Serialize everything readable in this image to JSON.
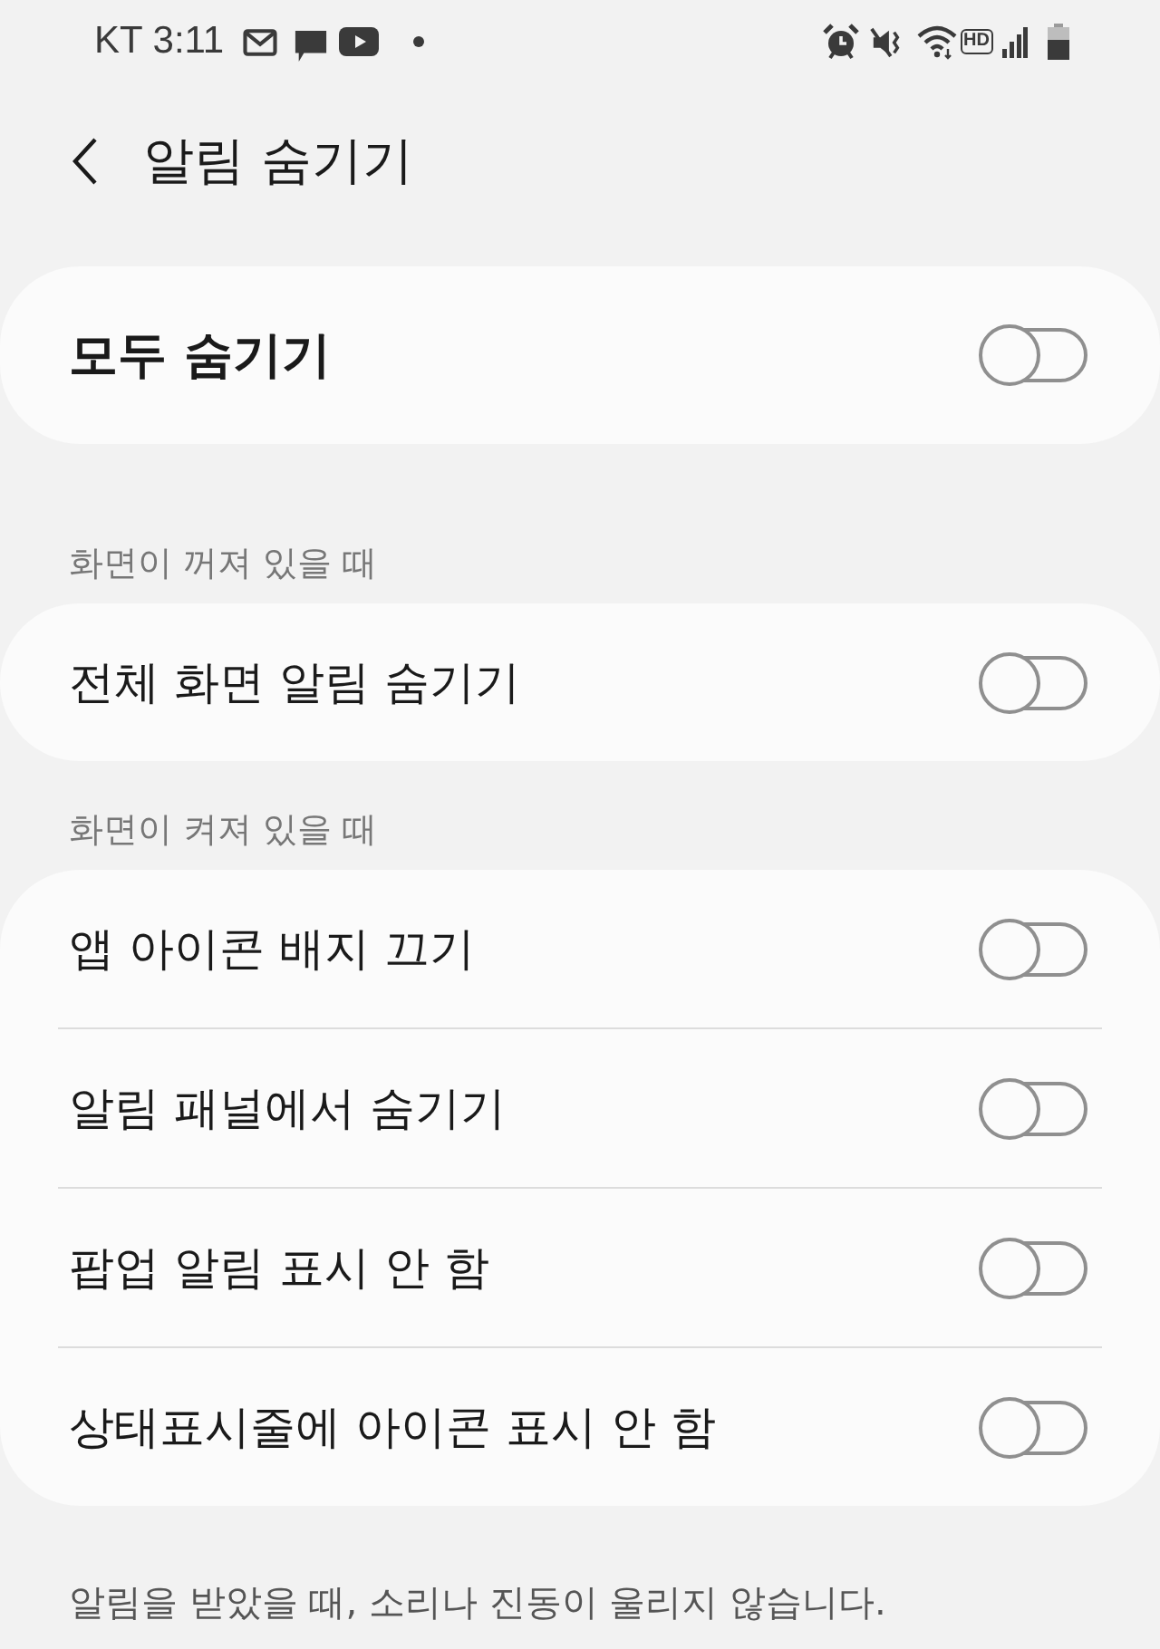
{
  "status_bar": {
    "carrier_time": "KT 3:11",
    "hd_badge": "HD"
  },
  "header": {
    "title": "알림 숨기기"
  },
  "master": {
    "label": "모두 숨기기",
    "on": false
  },
  "sections": [
    {
      "header": "화면이 꺼져 있을 때",
      "items": [
        {
          "label": "전체 화면 알림 숨기기",
          "on": false
        }
      ]
    },
    {
      "header": "화면이 켜져 있을 때",
      "items": [
        {
          "label": "앱 아이콘 배지 끄기",
          "on": false
        },
        {
          "label": "알림 패널에서 숨기기",
          "on": false
        },
        {
          "label": "팝업 알림 표시 안 함",
          "on": false
        },
        {
          "label": "상태표시줄에 아이콘 표시 안 함",
          "on": false
        }
      ]
    }
  ],
  "footer_note": "알림을 받았을 때, 소리나 진동이 울리지 않습니다."
}
